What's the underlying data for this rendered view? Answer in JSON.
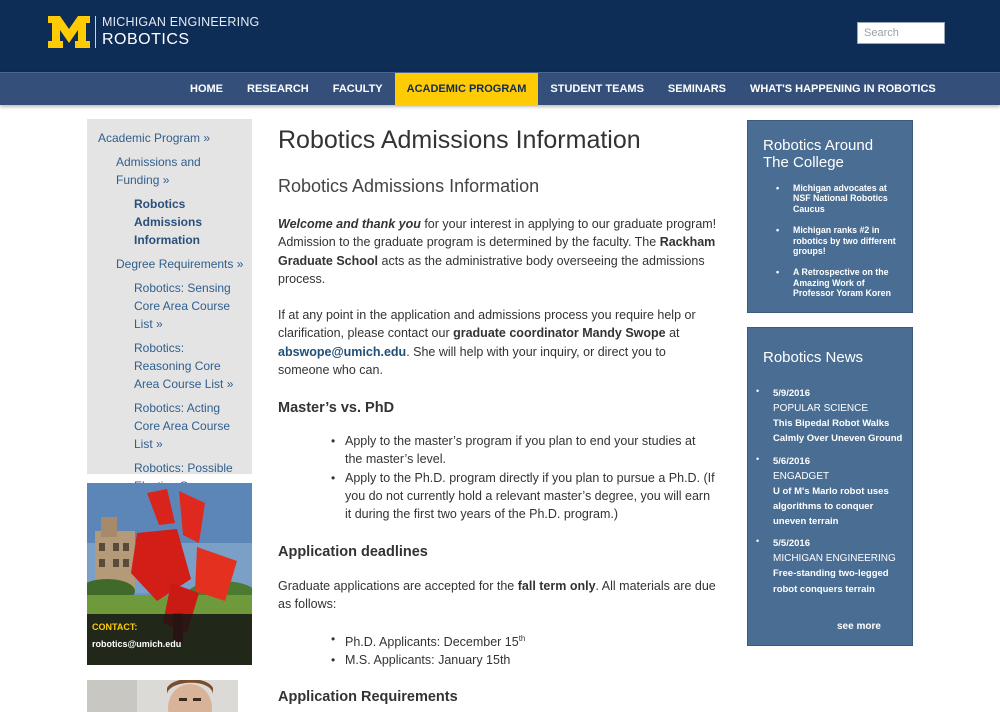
{
  "header": {
    "logo_letter": "M",
    "brand_line1": "MICHIGAN ENGINEERING",
    "brand_line2": "ROBOTICS",
    "search_placeholder": "Search"
  },
  "nav": {
    "items": [
      "HOME",
      "RESEARCH",
      "FACULTY",
      "ACADEMIC PROGRAM",
      "STUDENT TEAMS",
      "SEMINARS",
      "WHAT'S HAPPENING IN ROBOTICS"
    ],
    "active": "ACADEMIC PROGRAM"
  },
  "leftnav": {
    "items": [
      "Academic Program »",
      "Admissions and Funding »",
      "Robotics Admissions Information",
      "Degree Requirements »",
      "Robotics: Sensing Core Area Course List »",
      "Robotics: Reasoning Core Area Course List »",
      "Robotics: Acting Core Area Course List »",
      "Robotics: Possible Elective Courses »"
    ]
  },
  "contact": {
    "label": "CONTACT:",
    "email": "robotics@umich.edu"
  },
  "main": {
    "title": "Robotics Admissions Information",
    "subtitle": "Robotics Admissions Information",
    "intro_bold_italic": "Welcome and thank you",
    "intro_1": " for your interest in applying to our graduate program! Admission to the graduate program is determined by the faculty.  The ",
    "intro_bold": "Rackham Graduate School",
    "intro_2": " acts as the administrative body overseeing the admissions process.",
    "help_1": "If at any point in the application and admissions process you require help or clarification, please contact our ",
    "help_bold": "graduate coordinator Mandy Swope",
    "help_2": " at ",
    "help_email": "abswope@umich.edu",
    "help_3": ".  She will help with your inquiry, or direct you to someone who can.",
    "h_masters": "Master’s vs. PhD",
    "masters_list": [
      "Apply to the master’s program if you plan to end your studies at the master’s level.",
      "Apply to the Ph.D. program directly if you plan to pursue a Ph.D. (If you do not currently hold a relevant master’s degree, you will earn it during the first two years of the Ph.D. program.)"
    ],
    "h_deadlines": "Application deadlines",
    "deadlines_1": "Graduate applications are accepted for the ",
    "deadlines_bold": "fall term only",
    "deadlines_2": ". All materials are due as follows:",
    "deadline_phd": "Ph.D. Applicants: December 15",
    "deadline_phd_sup": "th",
    "deadline_ms": "M.S. Applicants: January 15th",
    "h_requirements": "Application Requirements"
  },
  "right": {
    "around_title": "Robotics Around The College",
    "around_items": [
      "Michigan advocates at NSF National Robotics Caucus",
      "Michigan ranks #2 in robotics by two different groups!",
      "A Retrospective on the Amazing Work of Professor Yoram Koren"
    ],
    "news_title": "Robotics News",
    "news": [
      {
        "date": "5/9/2016",
        "source": "POPULAR SCIENCE",
        "headline": "This Bipedal Robot Walks Calmly Over Uneven Ground"
      },
      {
        "date": "5/6/2016",
        "source": "ENGADGET",
        "headline": "U of M's Marlo robot uses algorithms to conquer uneven terrain"
      },
      {
        "date": "5/5/2016",
        "source": "MICHIGAN ENGINEERING",
        "headline": "Free-standing two-legged robot conquers terrain"
      }
    ],
    "see_more": "see more"
  },
  "colors": {
    "header_bg": "#0d2c56",
    "nav_bg": "#34507a",
    "accent_maize": "#ffcb05",
    "sidebar_box": "#4a6e93",
    "link_blue": "#2f5f8e"
  }
}
